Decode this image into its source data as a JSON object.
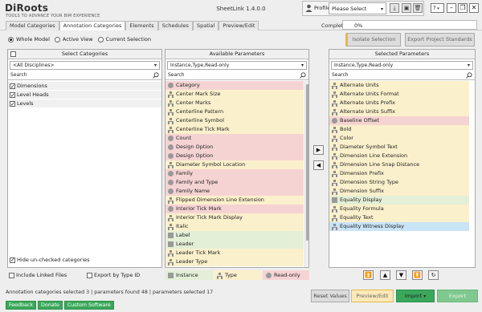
{
  "app": {
    "logo": "DiRoots",
    "logo_sub": "TOOLS TO ADVANCE YOUR BIM EXPERIENCE",
    "title": "SheetLink 1.4.0.0"
  },
  "profile": {
    "label": "Profile",
    "value": "Please Select",
    "icons": [
      "user-icon",
      "download-icon",
      "save-icon",
      "trash-icon"
    ],
    "help": "?",
    "window": [
      "minimize-icon",
      "restore-icon",
      "close-icon"
    ]
  },
  "tabs": [
    {
      "label": "Model Categories",
      "active": false
    },
    {
      "label": "Annotation Categories",
      "active": true
    },
    {
      "label": "Elements",
      "active": false
    },
    {
      "label": "Schedules",
      "active": false
    },
    {
      "label": "Spatial",
      "active": false
    },
    {
      "label": "Preview/Edit",
      "active": false
    }
  ],
  "progress": {
    "label": "Completed",
    "value": 0,
    "text": "0%"
  },
  "scope": {
    "options": [
      "Whole Model",
      "Active View",
      "Current Selection"
    ],
    "selected": "Whole Model"
  },
  "actions": {
    "isolate": "Isolate Selection",
    "export_standards": "Export Project Standards"
  },
  "categories": {
    "header": "Select Categories",
    "discipline": "<All Disciplines>",
    "search_placeholder": "Search",
    "items": [
      {
        "label": "Dimensions",
        "checked": true
      },
      {
        "label": "Level Heads",
        "checked": true
      },
      {
        "label": "Levels",
        "checked": true
      }
    ],
    "hide_unchecked": "Hide un-checked categories",
    "include_linked": "Include Linked Files",
    "export_by_type": "Export by Type ID"
  },
  "available": {
    "header": "Available Parameters",
    "filter": "Instance,Type,Read-only",
    "search_placeholder": "Search",
    "items": [
      {
        "label": "Category",
        "kind": "readonly"
      },
      {
        "label": "Center Mark Size",
        "kind": "type"
      },
      {
        "label": "Center Marks",
        "kind": "type"
      },
      {
        "label": "Centerline Pattern",
        "kind": "type"
      },
      {
        "label": "Centerline Symbol",
        "kind": "type"
      },
      {
        "label": "Centerline Tick Mark",
        "kind": "type"
      },
      {
        "label": "Count",
        "kind": "readonly"
      },
      {
        "label": "Design Option",
        "kind": "readonly"
      },
      {
        "label": "Design Option",
        "kind": "readonly"
      },
      {
        "label": "Diameter Symbol Location",
        "kind": "type"
      },
      {
        "label": "Family",
        "kind": "readonly"
      },
      {
        "label": "Family and Type",
        "kind": "readonly"
      },
      {
        "label": "Family Name",
        "kind": "readonly"
      },
      {
        "label": "Flipped Dimension Line Extension",
        "kind": "type"
      },
      {
        "label": "Interior Tick Mark",
        "kind": "readonly"
      },
      {
        "label": "Interior Tick Mark Display",
        "kind": "type"
      },
      {
        "label": "Italic",
        "kind": "type"
      },
      {
        "label": "Label",
        "kind": "instance"
      },
      {
        "label": "Leader",
        "kind": "instance"
      },
      {
        "label": "Leader Tick Mark",
        "kind": "type"
      },
      {
        "label": "Leader Type",
        "kind": "type"
      }
    ]
  },
  "selected": {
    "header": "Selected Parameters",
    "filter": "Instance,Type,Read-only",
    "search_placeholder": "Search",
    "items": [
      {
        "label": "Alternate Units",
        "kind": "type"
      },
      {
        "label": "Alternate Units Format",
        "kind": "type"
      },
      {
        "label": "Alternate Units Prefix",
        "kind": "type"
      },
      {
        "label": "Alternate Units Suffix",
        "kind": "type"
      },
      {
        "label": "Baseline Offset",
        "kind": "readonly"
      },
      {
        "label": "Bold",
        "kind": "type"
      },
      {
        "label": "Color",
        "kind": "type"
      },
      {
        "label": "Diameter Symbol Text",
        "kind": "type"
      },
      {
        "label": "Dimension Line Extension",
        "kind": "type"
      },
      {
        "label": "Dimension Line Snap Distance",
        "kind": "type"
      },
      {
        "label": "Dimension Prefix",
        "kind": "type"
      },
      {
        "label": "Dimension String Type",
        "kind": "type"
      },
      {
        "label": "Dimension Suffix",
        "kind": "type"
      },
      {
        "label": "Equality Display",
        "kind": "instance"
      },
      {
        "label": "Equality Formula",
        "kind": "type"
      },
      {
        "label": "Equality Text",
        "kind": "type"
      },
      {
        "label": "Equality Witness Display",
        "kind": "selected"
      }
    ]
  },
  "legend": {
    "instance": "Instance",
    "type": "Type",
    "readonly": "Read-only"
  },
  "footer": {
    "status": "Annotation categories selected 3 | parameters found 48 | parameters selected 17",
    "reset": "Reset Values",
    "preview": "Preview/Edit",
    "import": "Import",
    "export": "Export",
    "links": [
      "Feedback",
      "Donate",
      "Custom Software"
    ]
  },
  "colors": {
    "readonly": "#f6d3d3",
    "instance": "#e3efd6",
    "type": "#fbf0cc",
    "selected": "#c9e4f7",
    "accent_green": "#3aa85a",
    "accent_yellow": "#e6b84a"
  }
}
